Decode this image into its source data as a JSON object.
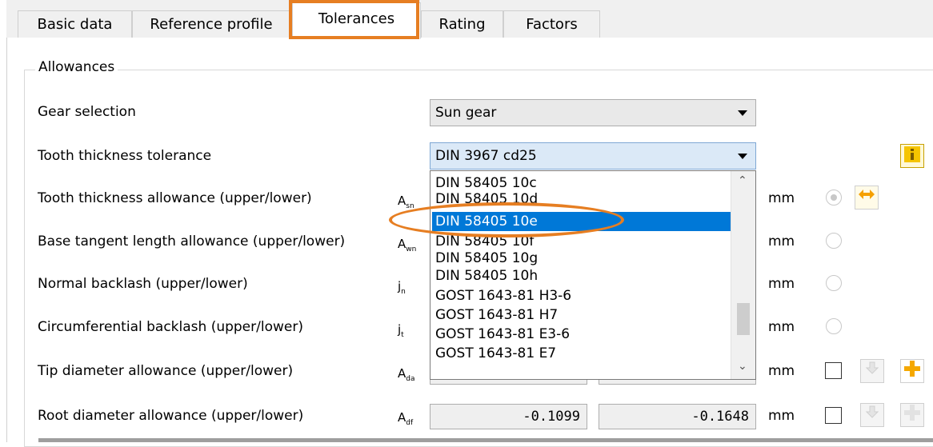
{
  "tabs": [
    "Basic data",
    "Reference profile",
    "Tolerances",
    "Rating",
    "Factors"
  ],
  "group_title": "Allowances",
  "rows": {
    "gear_selection": "Gear selection",
    "tooth_thickness_tolerance": "Tooth thickness tolerance",
    "tooth_thickness_allowance": "Tooth thickness allowance (upper/lower)",
    "base_tangent": "Base tangent length allowance (upper/lower)",
    "normal_backlash": "Normal backlash (upper/lower)",
    "circ_backlash": "Circumferential backlash (upper/lower)",
    "tip_diameter": "Tip diameter allowance (upper/lower)",
    "root_diameter": "Root diameter allowance (upper/lower)"
  },
  "symbols": {
    "asn": {
      "base": "A",
      "sub": "sn"
    },
    "awn": {
      "base": "A",
      "sub": "wn"
    },
    "jn": {
      "base": "j",
      "sub": "n"
    },
    "jt": {
      "base": "j",
      "sub": "t"
    },
    "ada": {
      "base": "A",
      "sub": "da"
    },
    "adf": {
      "base": "A",
      "sub": "df"
    }
  },
  "combos": {
    "gear_selection": "Sun gear",
    "tooth_thickness_tolerance": "DIN 3967 cd25"
  },
  "dropdown_options": [
    "DIN 58405 10c",
    "DIN 58405 10d",
    "DIN 58405 10e",
    "DIN 58405 10f",
    "DIN 58405 10g",
    "DIN 58405 10h",
    "GOST 1643-81 H3-6",
    "GOST 1643-81 H7",
    "GOST 1643-81 E3-6",
    "GOST 1643-81 E7"
  ],
  "dropdown_selected": "DIN 58405 10e",
  "unit": "mm",
  "root_diameter_values": {
    "upper": "-0.1099",
    "lower": "-0.1648"
  },
  "icons": {
    "info": "info-icon",
    "swap": "swap-arrows-icon",
    "plus": "plus-icon",
    "arrow": "arrow-down-icon"
  },
  "colors": {
    "highlight": "#e67e22",
    "selection": "#0078d7",
    "icon_yellow": "#f5c400"
  }
}
